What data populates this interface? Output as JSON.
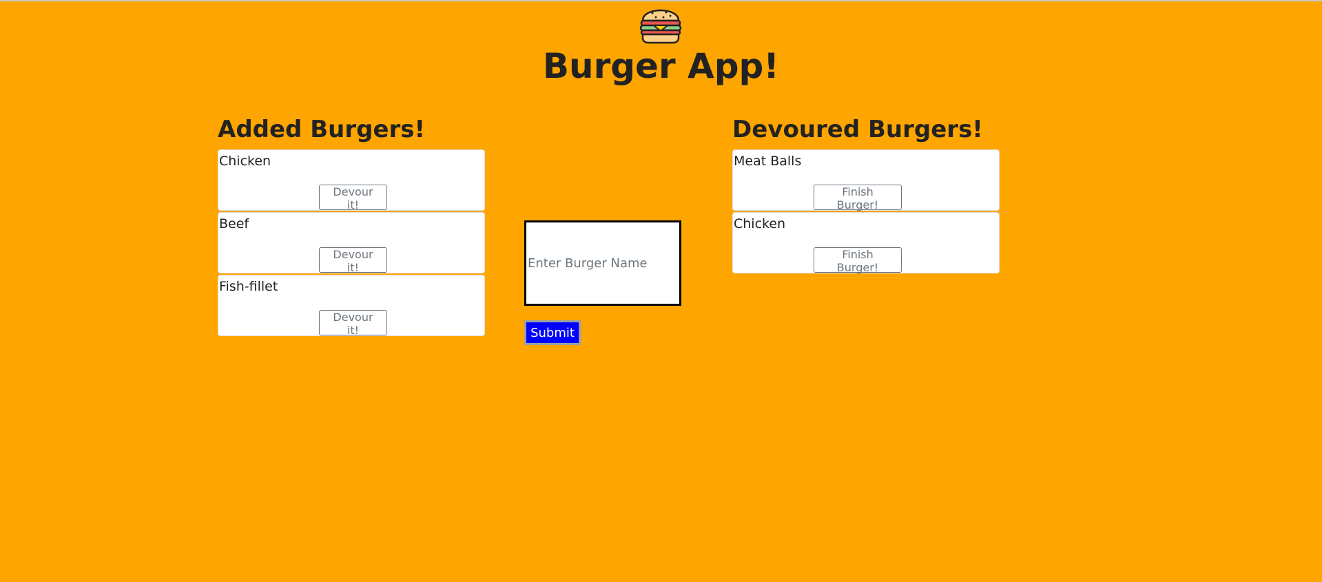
{
  "app": {
    "title": "Burger App!"
  },
  "added": {
    "heading": "Added Burgers!",
    "items": [
      {
        "name": "Chicken",
        "button": "Devour it!"
      },
      {
        "name": "Beef",
        "button": "Devour it!"
      },
      {
        "name": "Fish-fillet",
        "button": "Devour it!"
      }
    ]
  },
  "form": {
    "placeholder": "Enter Burger Name",
    "value": "",
    "submit_label": "Submit"
  },
  "devoured": {
    "heading": "Devoured Burgers!",
    "items": [
      {
        "name": "Meat Balls",
        "button": "Finish Burger!"
      },
      {
        "name": "Chicken",
        "button": "Finish Burger!"
      }
    ]
  },
  "icons": {
    "logo": "burger-icon"
  },
  "colors": {
    "background": "#ffa500",
    "submit": "#0000ff"
  }
}
